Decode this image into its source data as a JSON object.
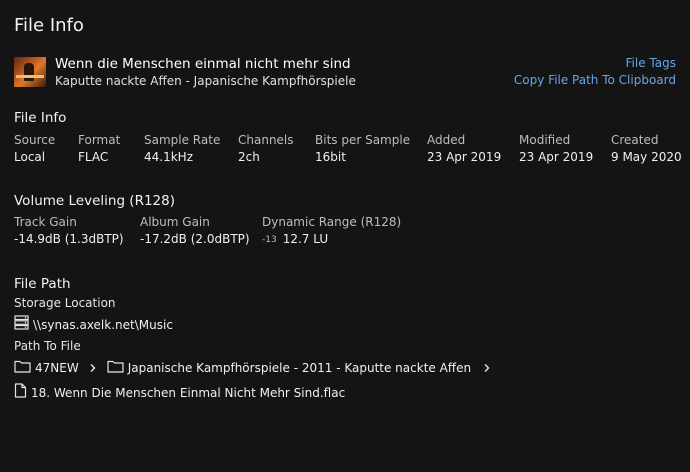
{
  "page": {
    "title": "File Info"
  },
  "track": {
    "title": "Wenn die Menschen einmal nicht mehr sind",
    "subtitle": "Kaputte nackte Affen - Japanische Kampfhörspiele"
  },
  "links": {
    "file_tags": "File Tags",
    "copy_path": "Copy File Path To Clipboard"
  },
  "file_info": {
    "heading": "File Info",
    "fields": [
      {
        "label": "Source",
        "value": "Local"
      },
      {
        "label": "Format",
        "value": "FLAC"
      },
      {
        "label": "Sample Rate",
        "value": "44.1kHz"
      },
      {
        "label": "Channels",
        "value": "2ch"
      },
      {
        "label": "Bits per Sample",
        "value": "16bit"
      },
      {
        "label": "Added",
        "value": "23 Apr 2019"
      },
      {
        "label": "Modified",
        "value": "23 Apr 2019"
      },
      {
        "label": "Created",
        "value": "9 May 2020"
      }
    ]
  },
  "volume": {
    "heading": "Volume Leveling (R128)",
    "fields": [
      {
        "label": "Track Gain",
        "value": "-14.9dB  (1.3dBTP)"
      },
      {
        "label": "Album Gain",
        "value": "-17.2dB (2.0dBTP)"
      },
      {
        "label": "Dynamic Range (R128)",
        "prefix": "-13",
        "value": "12.7 LU"
      }
    ]
  },
  "file_path": {
    "heading": "File Path",
    "storage_label": "Storage Location",
    "storage_value": "\\\\synas.axelk.net\\Music",
    "path_label": "Path To File",
    "folders": [
      "47NEW",
      "Japanische Kampfhörspiele - 2011 - Kaputte nackte Affen"
    ],
    "filename": "18. Wenn Die Menschen Einmal Nicht Mehr Sind.flac"
  },
  "icons": {
    "storage": "server-icon",
    "folder": "folder-icon",
    "chevron": "chevron-right-icon",
    "file": "file-icon"
  },
  "colors": {
    "background": "#141414",
    "link": "#6aa3ea"
  }
}
